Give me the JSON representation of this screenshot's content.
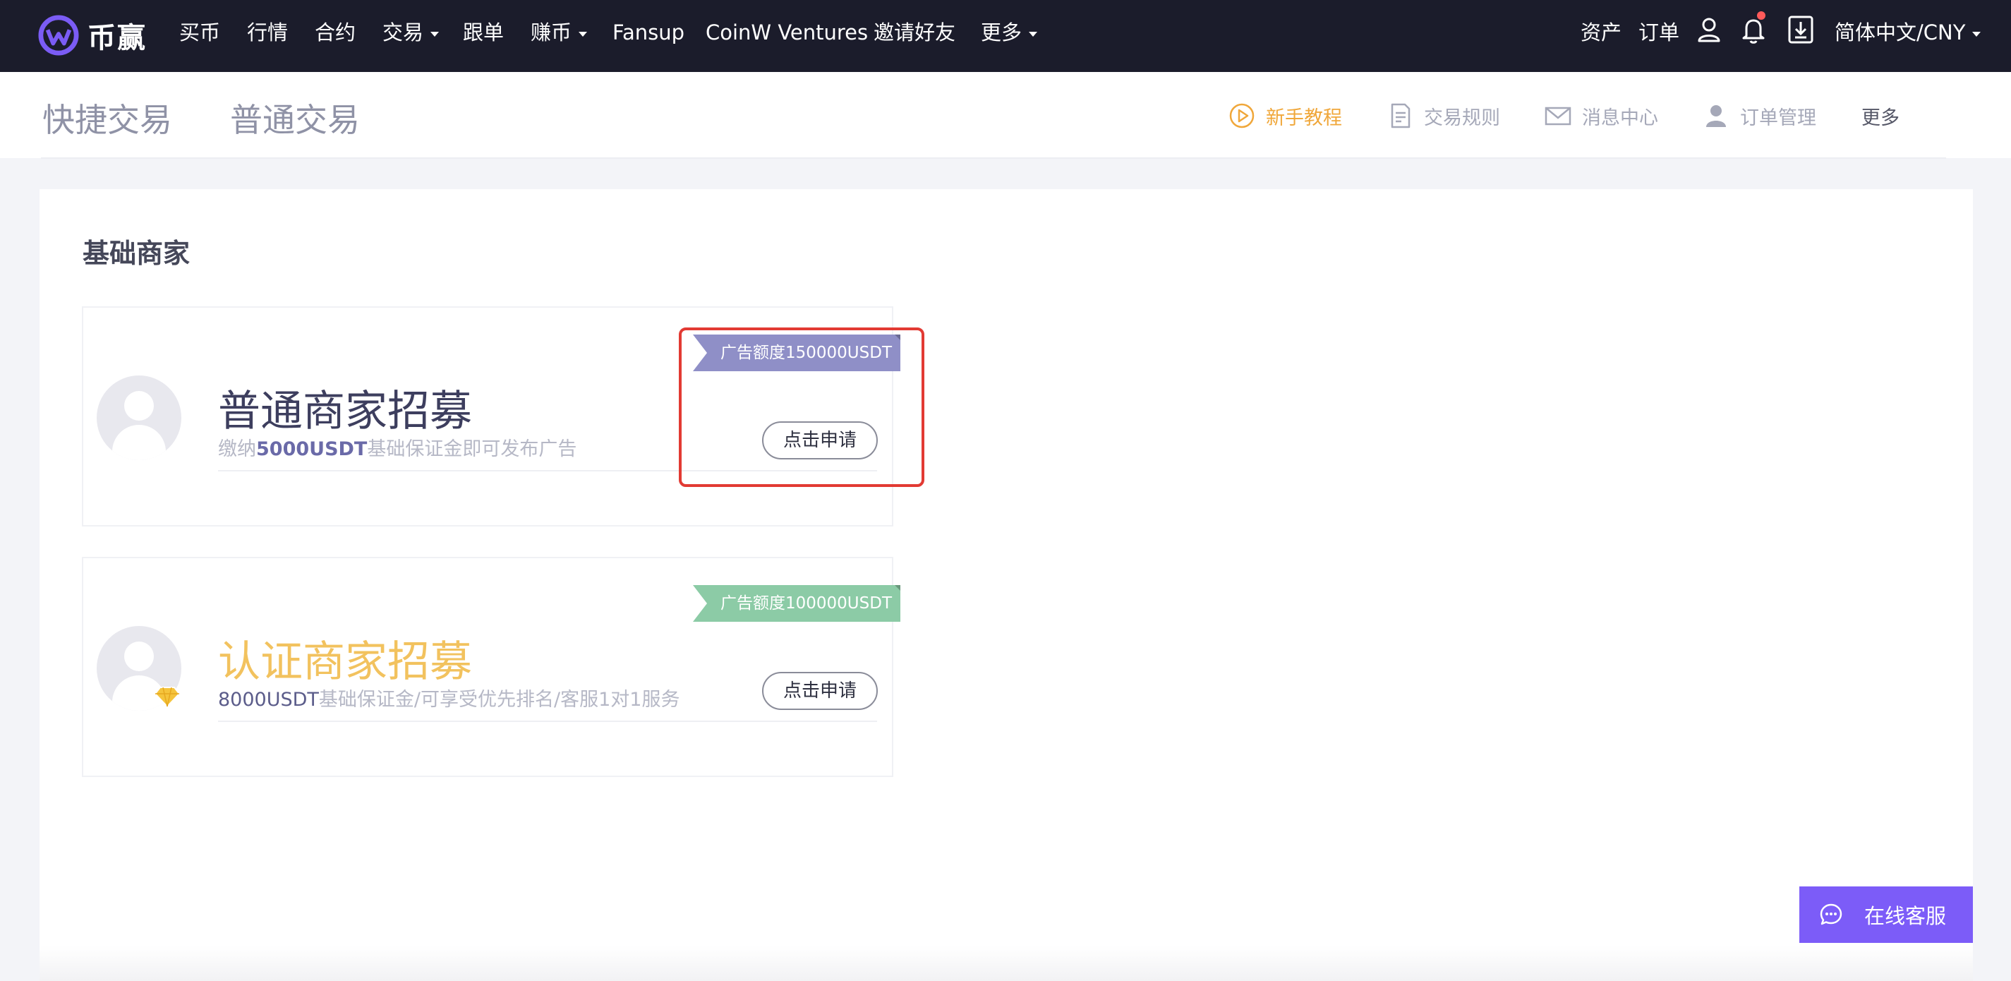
{
  "nav": {
    "logo_text": "币赢",
    "items": [
      {
        "label": "买币",
        "dropdown": false
      },
      {
        "label": "行情",
        "dropdown": false
      },
      {
        "label": "合约",
        "dropdown": false
      },
      {
        "label": "交易",
        "dropdown": true
      },
      {
        "label": "跟单",
        "dropdown": false
      },
      {
        "label": "赚币",
        "dropdown": true
      },
      {
        "label": "Fansup",
        "dropdown": false
      },
      {
        "label": "CoinW Ventures",
        "dropdown": false
      },
      {
        "label": "邀请好友",
        "dropdown": false
      },
      {
        "label": "更多",
        "dropdown": true
      }
    ],
    "right": {
      "assets": "资产",
      "orders": "订单",
      "language": "简体中文/CNY"
    }
  },
  "subheader": {
    "tabs": [
      "快捷交易",
      "普通交易"
    ],
    "tools": [
      "新手教程",
      "交易规则",
      "消息中心",
      "订单管理",
      "更多"
    ]
  },
  "main": {
    "section_title": "基础商家",
    "cards": [
      {
        "title": "普通商家招募",
        "desc_prefix": "缴纳",
        "desc_highlight": "5000USDT",
        "desc_suffix": "基础保证金即可发布广告",
        "ribbon": "广告额度150000USDT",
        "button": "点击申请"
      },
      {
        "title": "认证商家招募",
        "desc_prefix": "",
        "desc_highlight": "8000USDT",
        "desc_suffix": "基础保证金/可享受优先排名/客服1对1服务",
        "ribbon": "广告额度100000USDT",
        "button": "点击申请"
      }
    ]
  },
  "support": {
    "label": "在线客服"
  },
  "colors": {
    "nav_bg": "#1b1c2b",
    "accent_orange": "#f0a73a",
    "ribbon_purple": "#8f8fc7",
    "ribbon_green": "#8ccba6",
    "title_gold": "#f2c25e",
    "title_navy": "#3d3e5e",
    "support_purple": "#7c5cf8",
    "highlight_red": "#e23a33"
  }
}
